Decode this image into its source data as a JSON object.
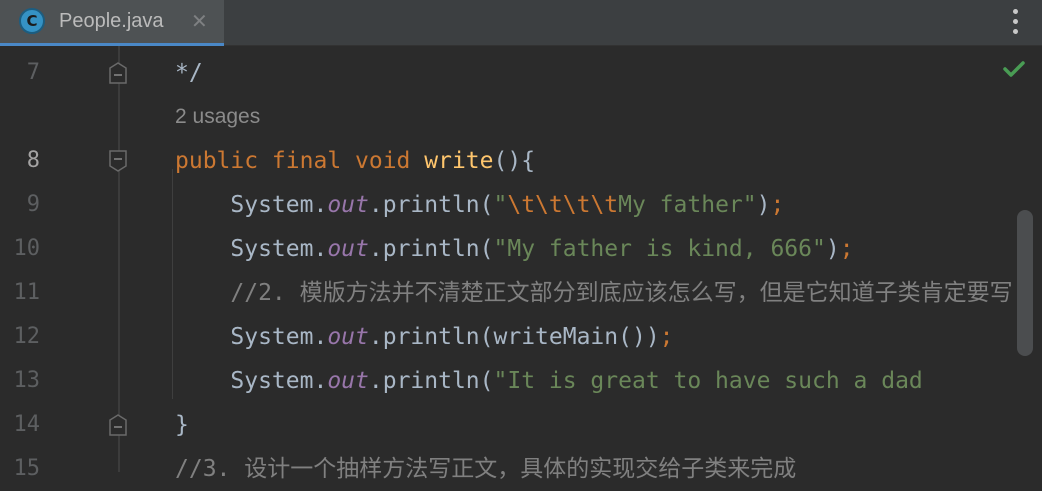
{
  "tab": {
    "icon_letter": "C",
    "filename": "People.java",
    "close_glyph": "✕"
  },
  "status": {
    "inspection_icon": "check-icon",
    "color": "#499c54"
  },
  "editor": {
    "lines": [
      {
        "num": "7",
        "text": "*/"
      },
      {
        "usages": "2 usages"
      },
      {
        "num": "8",
        "kw1": "public final void ",
        "method": "write",
        "rest": "(){"
      },
      {
        "num": "9",
        "prefix": "    System.",
        "field": "out",
        "call": ".println(",
        "str_open": "\"",
        "escapes": "\\t\\t\\t\\t",
        "str_body": "My father\"",
        "close": ")",
        "semi": ";"
      },
      {
        "num": "10",
        "prefix": "    System.",
        "field": "out",
        "call": ".println(",
        "str_body": "\"My father is kind, 666\"",
        "close": ")",
        "semi": ";"
      },
      {
        "num": "11",
        "comment": "    //2. 模版方法并不清楚正文部分到底应该怎么写，但是它知道子类肯定要写"
      },
      {
        "num": "12",
        "prefix": "    System.",
        "field": "out",
        "call": ".println(writeMain())",
        "semi": ";"
      },
      {
        "num": "13",
        "prefix": "    System.",
        "field": "out",
        "call": ".println(",
        "str_body": "\"It is great to have such a dad"
      },
      {
        "num": "14",
        "text": "}"
      },
      {
        "num": "15",
        "comment": "//3. 设计一个抽样方法写正文，具体的实现交给子类来完成"
      }
    ]
  }
}
